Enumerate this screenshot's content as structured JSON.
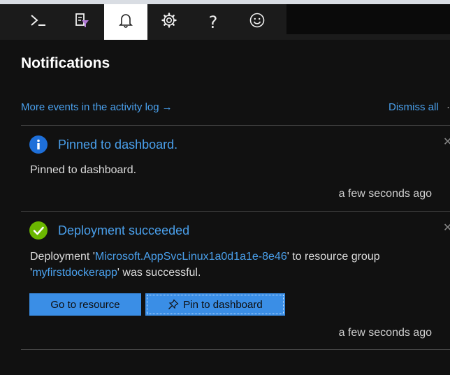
{
  "toolbar": {
    "items": [
      {
        "icon": "terminal-icon"
      },
      {
        "icon": "directory-filter-icon"
      },
      {
        "icon": "bell-icon",
        "active": true
      },
      {
        "icon": "gear-icon"
      },
      {
        "icon": "question-icon",
        "glyph": "?"
      },
      {
        "icon": "smiley-icon"
      }
    ]
  },
  "panel": {
    "title": "Notifications",
    "activity_link": "More events in the activity log",
    "activity_arrow": "→",
    "dismiss_all": "Dismiss all"
  },
  "notifications": [
    {
      "type": "info",
      "icon": "info-icon",
      "icon_color": "#1e6fd9",
      "title": "Pinned to dashboard.",
      "body": "Pinned to dashboard.",
      "time": "a few seconds ago"
    },
    {
      "type": "success",
      "icon": "checkmark-icon",
      "icon_color": "#6bb700",
      "title": "Deployment succeeded",
      "body_prefix": "Deployment '",
      "deployment_name": "Microsoft.AppSvcLinux1a0d1a1e-8e46",
      "body_middle": "' to resource group",
      "body_quote_open": "'",
      "resource_group": "myfirstdockerapp",
      "body_suffix": "' was successful.",
      "primary_button": "Go to resource",
      "secondary_button": "Pin to dashboard",
      "time": "a few seconds ago"
    }
  ],
  "colors": {
    "accent": "#4aa0ec",
    "button": "#3a8ee6",
    "background": "#111111"
  }
}
